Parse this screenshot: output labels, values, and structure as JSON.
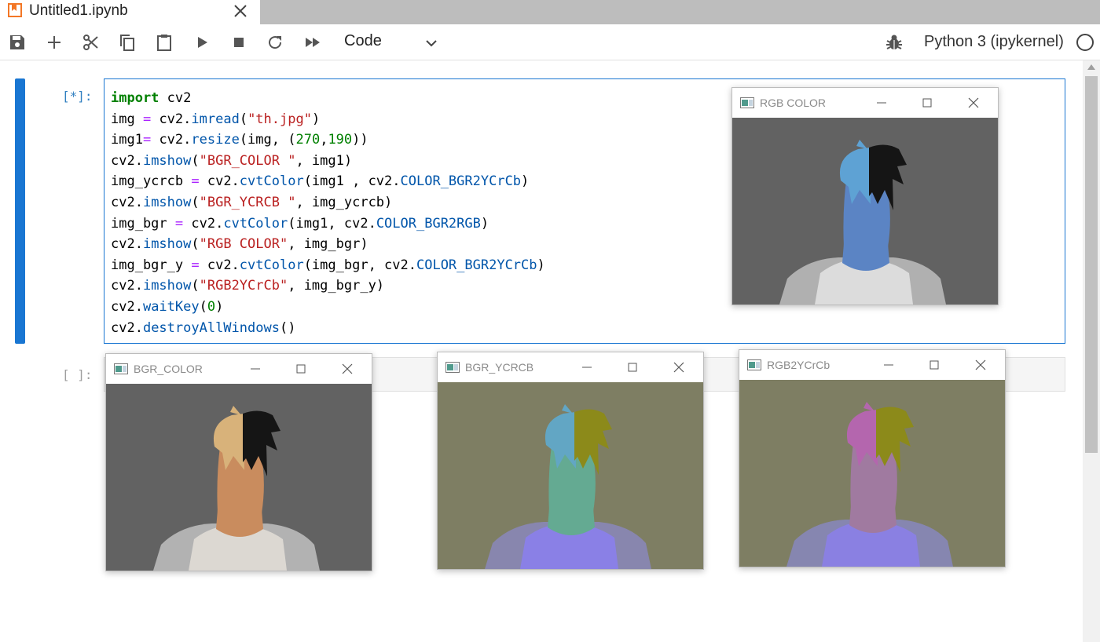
{
  "tab": {
    "title": "Untitled1.ipynb",
    "icon": "notebook-icon"
  },
  "toolbar": {
    "buttons": [
      "save-icon",
      "add-icon",
      "cut-icon",
      "copy-icon",
      "paste-icon",
      "run-icon",
      "stop-icon",
      "restart-icon",
      "fast-forward-icon"
    ],
    "cell_type": "Code",
    "kernel": "Python 3 (ipykernel)"
  },
  "cells": [
    {
      "prompt": "[*]:",
      "code_lines": [
        "import cv2",
        "img = cv2.imread(\"th.jpg\")",
        "img1= cv2.resize(img, (270,190))",
        "cv2.imshow(\"BGR_COLOR \", img1)",
        "img_ycrcb = cv2.cvtColor(img1 , cv2.COLOR_BGR2YCrCb)",
        "cv2.imshow(\"BGR_YCRCB \", img_ycrcb)",
        "img_bgr = cv2.cvtColor(img1, cv2.COLOR_BGR2RGB)",
        "cv2.imshow(\"RGB COLOR\", img_bgr)",
        "img_bgr_y = cv2.cvtColor(img_bgr, cv2.COLOR_BGR2YCrCb)",
        "cv2.imshow(\"RGB2YCrCb\", img_bgr_y)",
        "cv2.waitKey(0)",
        "cv2.destroyAllWindows()"
      ]
    },
    {
      "prompt": "[ ]:",
      "code_lines": []
    }
  ],
  "windows": [
    {
      "title": "RGB COLOR",
      "colors": {
        "bg": "#626262",
        "hair": "#5ea2d4",
        "hair_dark": "#151515",
        "skin": "#5b84c4",
        "shirt": "#dcdcdc",
        "sleeve": "#b0b0b0"
      }
    },
    {
      "title": "BGR_COLOR",
      "colors": {
        "bg": "#626262",
        "hair": "#d8b27a",
        "hair_dark": "#151515",
        "skin": "#c98c5e",
        "shirt": "#dcd8d2",
        "sleeve": "#b2b2b2"
      }
    },
    {
      "title": "BGR_YCRCB",
      "colors": {
        "bg": "#7e7e63",
        "hair": "#62a6c4",
        "hair_dark": "#8c8a1a",
        "skin": "#64aa92",
        "shirt": "#8a80e6",
        "sleeve": "#8886ae"
      }
    },
    {
      "title": "RGB2YCrCb",
      "colors": {
        "bg": "#7e7e63",
        "hair": "#b466ae",
        "hair_dark": "#8c8a1a",
        "skin": "#a07aa0",
        "shirt": "#8a80e2",
        "sleeve": "#8686b0"
      }
    }
  ]
}
